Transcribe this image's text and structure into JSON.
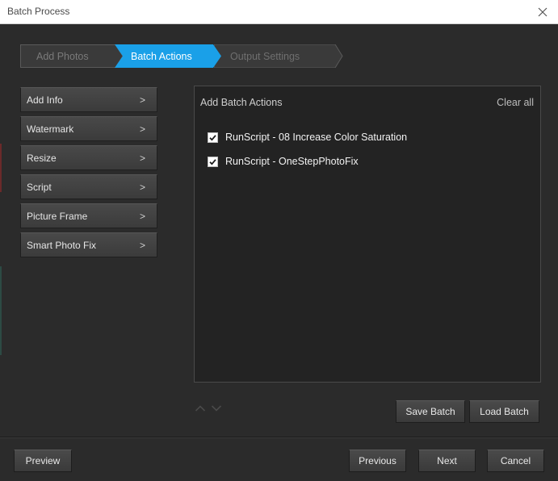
{
  "window": {
    "title": "Batch Process"
  },
  "steps": [
    {
      "label": "Add Photos",
      "state": "done"
    },
    {
      "label": "Batch Actions",
      "state": "active"
    },
    {
      "label": "Output Settings",
      "state": "pending"
    }
  ],
  "actions": [
    {
      "label": "Add Info",
      "chevron": ">"
    },
    {
      "label": "Watermark",
      "chevron": ">"
    },
    {
      "label": "Resize",
      "chevron": ">"
    },
    {
      "label": "Script",
      "chevron": ">"
    },
    {
      "label": "Picture Frame",
      "chevron": ">"
    },
    {
      "label": "Smart Photo Fix",
      "chevron": ">"
    }
  ],
  "batch_panel": {
    "header": "Add Batch Actions",
    "clear_all": "Clear all",
    "items": [
      {
        "label": "RunScript - 08 Increase Color Saturation",
        "checked": true
      },
      {
        "label": "RunScript - OneStepPhotoFix",
        "checked": true
      }
    ]
  },
  "buttons": {
    "save_batch": "Save Batch",
    "load_batch": "Load Batch",
    "preview": "Preview",
    "previous": "Previous",
    "next": "Next",
    "cancel": "Cancel"
  },
  "colors": {
    "accent": "#1aa0e8",
    "background": "#2b2b2b",
    "panel": "#232323"
  }
}
